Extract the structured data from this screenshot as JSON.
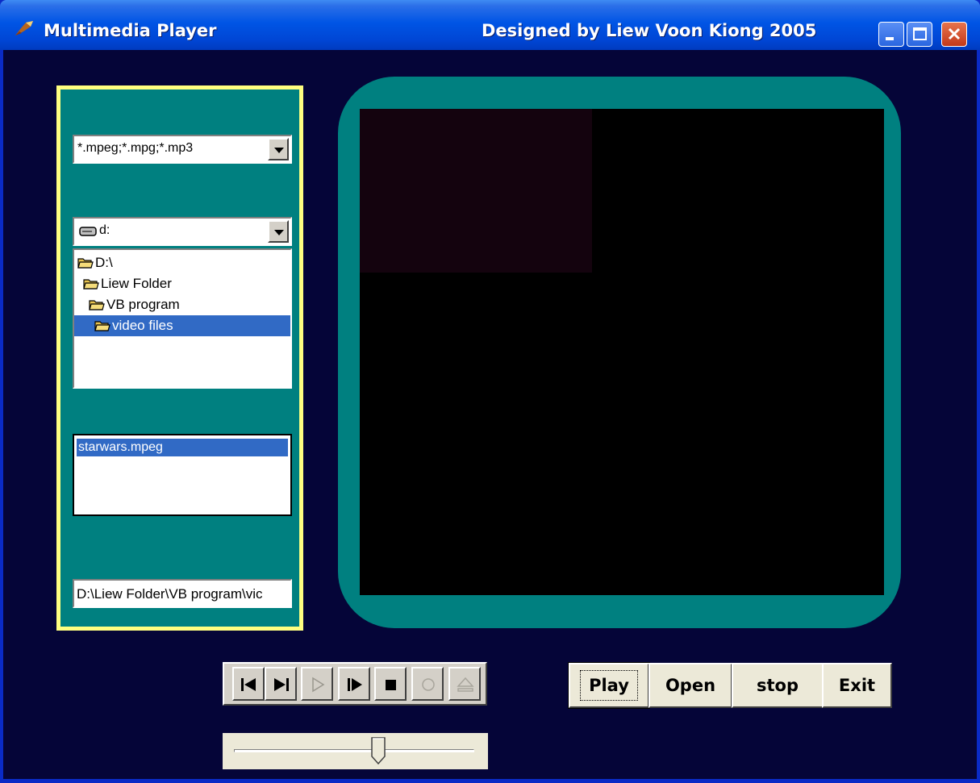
{
  "window": {
    "title": "Multimedia Player",
    "credit": "Designed by Liew Voon Kiong 2005"
  },
  "file_pattern": {
    "selected": "*.mpeg;*.mpg;*.mp3"
  },
  "drive": {
    "selected": "d:"
  },
  "directories": [
    {
      "label": "D:\\"
    },
    {
      "label": "Liew Folder"
    },
    {
      "label": "VB program"
    },
    {
      "label": "video files",
      "selected": true
    }
  ],
  "files": [
    {
      "label": "starwars.mpeg",
      "selected": true
    }
  ],
  "path_field": {
    "value": "D:\\Liew Folder\\VB program\\vic"
  },
  "media_controls": {
    "buttons": [
      "prev-icon",
      "next-icon",
      "play-icon",
      "step-icon",
      "stop-icon",
      "record-icon",
      "eject-icon"
    ],
    "slider_position": 0.6
  },
  "actions": {
    "play": "Play",
    "open": "Open",
    "stop": "stop",
    "exit": "Exit"
  },
  "colors": {
    "background": "#050538",
    "panel": "#008080",
    "panel_border": "#ffff80",
    "selection": "#316ac5"
  }
}
